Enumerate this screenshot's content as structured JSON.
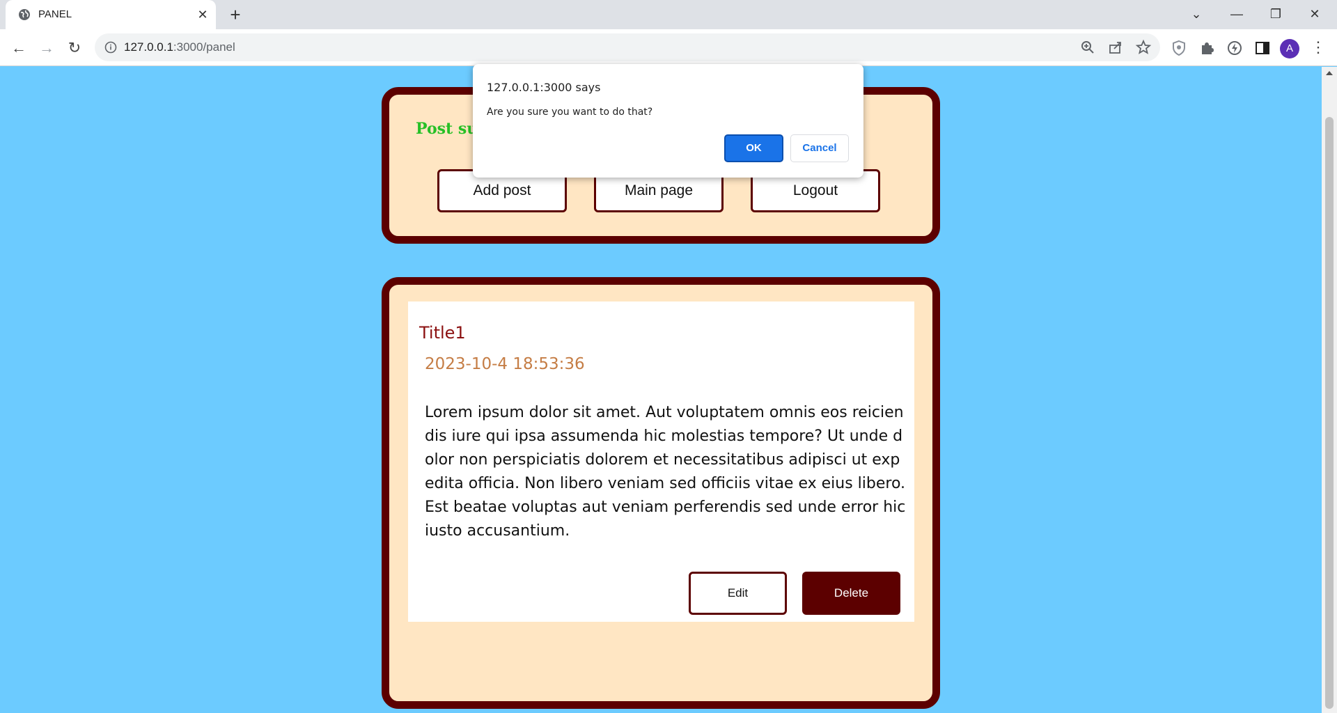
{
  "browser": {
    "tab_title": "PANEL",
    "url_host": "127.0.0.1",
    "url_rest": ":3000/panel",
    "avatar_letter": "A",
    "icons": [
      "globe-icon",
      "close-icon",
      "plus-icon",
      "chevron-down-icon",
      "minimize-icon",
      "restore-icon",
      "window-close-icon",
      "back-arrow-icon",
      "forward-arrow-icon",
      "reload-icon",
      "info-icon",
      "zoom-icon",
      "share-icon",
      "star-icon",
      "shield-icon",
      "puzzle-icon",
      "lightning-icon",
      "sidebar-icon",
      "kebab-menu-icon"
    ]
  },
  "panel": {
    "status_message": "Post succusfully edited.",
    "status_color": "#26c026",
    "buttons": {
      "add_post": "Add post",
      "main_page": "Main page",
      "logout": "Logout"
    }
  },
  "post": {
    "title": "Title1",
    "date": "2023-10-4 18:53:36",
    "body": "Lorem ipsum dolor sit amet. Aut voluptatem omnis eos reiciendis iure qui ipsa assumenda hic molestias tempore? Ut unde dolor non perspiciatis dolorem et necessitatibus adipisci ut expedita officia. Non libero veniam sed officiis vitae ex eius libero. Est beatae voluptas aut veniam perferendis sed unde error hic iusto accusantium.",
    "edit_label": "Edit",
    "delete_label": "Delete"
  },
  "dialog": {
    "title": "127.0.0.1:3000 says",
    "message": "Are you sure you want to do that?",
    "ok_label": "OK",
    "cancel_label": "Cancel"
  },
  "colors": {
    "page_background": "#6ccbff",
    "card_border": "#5c0000",
    "card_fill": "#ffe6c3",
    "accent_blue": "#1a73e8"
  }
}
